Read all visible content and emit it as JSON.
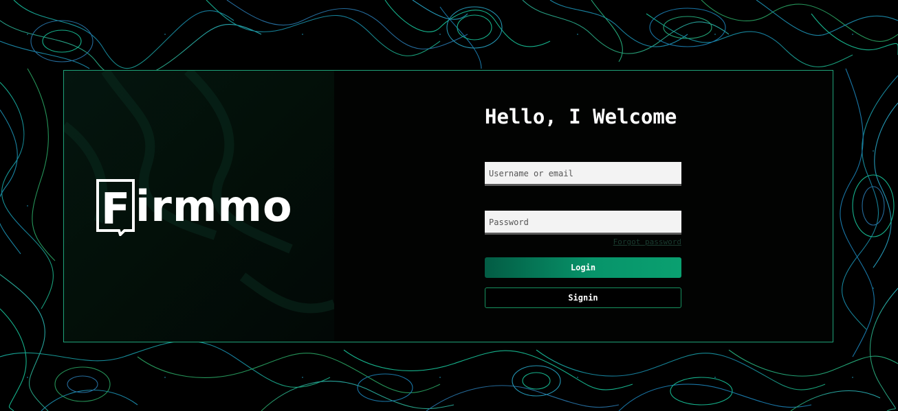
{
  "brand": {
    "name": "irmmo",
    "initial": "F"
  },
  "form": {
    "title": "Hello, I Welcome",
    "username_placeholder": "Username or email",
    "username_value": "",
    "password_placeholder": "Password",
    "password_value": "",
    "forgot_label": "Forgot password",
    "login_label": "Login",
    "signin_label": "Signin"
  },
  "colors": {
    "accent": "#1fa37a",
    "login_gradient_start": "#035c44",
    "login_gradient_end": "#0aa070",
    "signin_border": "#17925f",
    "background": "#000000"
  },
  "icons": {
    "logo": "firmmo-logo-icon",
    "background": "topographic-lines-background"
  }
}
